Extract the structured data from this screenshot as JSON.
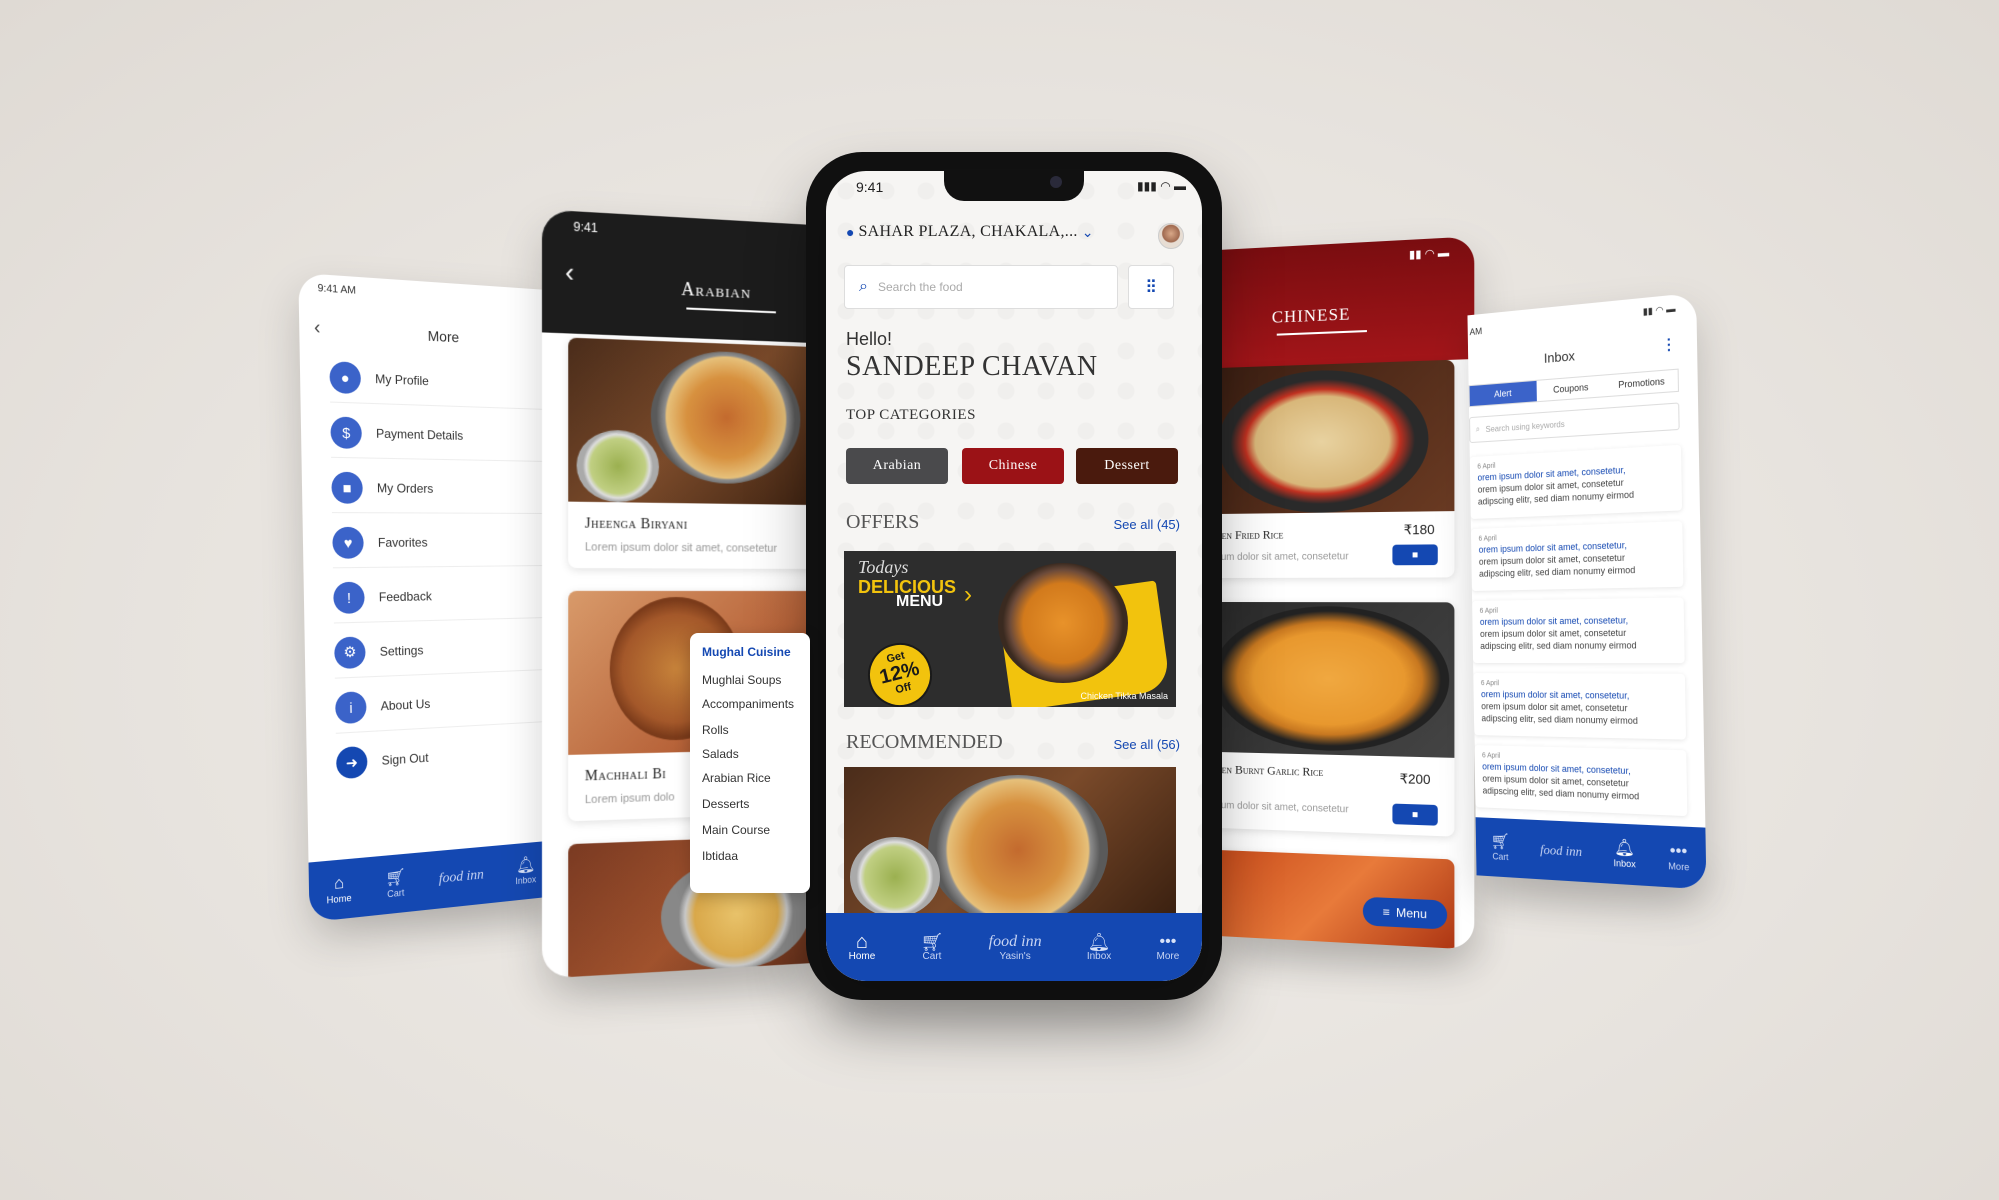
{
  "colors": {
    "brand_blue": "#1448b2",
    "arabian_grey": "#4a4a4c",
    "chinese_red": "#9b1216",
    "dessert_brown": "#4a1a0d"
  },
  "more_screen": {
    "status_time": "9:41 AM",
    "title": "More",
    "items": [
      {
        "label": "My Profile",
        "icon": "user-icon"
      },
      {
        "label": "Payment Details",
        "icon": "payment-icon"
      },
      {
        "label": "My Orders",
        "icon": "bag-icon"
      },
      {
        "label": "Favorites",
        "icon": "heart-icon"
      },
      {
        "label": "Feedback",
        "icon": "feedback-icon"
      },
      {
        "label": "Settings",
        "icon": "gear-icon"
      },
      {
        "label": "About Us",
        "icon": "info-icon"
      },
      {
        "label": "Sign Out",
        "icon": "signout-icon"
      }
    ],
    "nav": {
      "home": "Home",
      "cart": "Cart",
      "inbox": "Inbox"
    }
  },
  "arabian_screen": {
    "status_time": "9:41",
    "title": "Arabian",
    "cards": [
      {
        "name": "Jheenga Biryani",
        "desc": "Lorem ipsum dolor sit amet, consetetur"
      },
      {
        "name": "Machhali Bi",
        "desc": "Lorem ipsum dolo"
      }
    ],
    "menu_dropdown": [
      "Mughal Cuisine",
      "Mughlai Soups",
      "Accompaniments",
      "Rolls",
      "Salads",
      "Arabian Rice",
      "Desserts",
      "Main Course",
      "Ibtidaa"
    ]
  },
  "home_screen": {
    "status_time": "9:41",
    "location": "Sahar Plaza, Chakala,...",
    "search_placeholder": "Search the food",
    "greeting": "Hello!",
    "user_name": "Sandeep Chavan",
    "categories_title": "Top Categories",
    "categories": [
      "Arabian",
      "Chinese",
      "Dessert"
    ],
    "offers_title": "Offers",
    "offers_see_all": "See all (45)",
    "banner": {
      "line1": "Todays",
      "line2": "DELICIOUS",
      "line3": "MENU",
      "badge_get": "Get",
      "badge_pct": "12%",
      "badge_off": "Off",
      "dish": "Chicken Tikka Masala"
    },
    "recommended_title": "Recommended",
    "recommended_see_all": "See all (56)",
    "nav": {
      "home": "Home",
      "cart": "Cart",
      "brand": "Yasin's",
      "inbox": "Inbox",
      "more": "More"
    }
  },
  "chinese_screen": {
    "title": "Chinese",
    "cards": [
      {
        "name": "ken Fried Rice",
        "price": "₹180",
        "desc": "sum dolor sit amet, consetetur"
      },
      {
        "name": "ken Burnt Garlic Rice",
        "price": "₹200",
        "desc": "sum dolor sit amet, consetetur"
      }
    ],
    "menu_button": "Menu"
  },
  "inbox_screen": {
    "status_time": "AM",
    "title": "Inbox",
    "tabs": [
      "Alert",
      "Coupons",
      "Promotions"
    ],
    "search_placeholder": "Search using keywords",
    "messages": [
      {
        "date": "6 April",
        "line1": "orem ipsum dolor sit amet, consetetur,",
        "line2": "orem ipsum dolor sit amet, consetetur",
        "line3": "adipscing elitr, sed diam nonumy eirmod"
      },
      {
        "date": "6 April",
        "line1": "orem ipsum dolor sit amet, consetetur,",
        "line2": "orem ipsum dolor sit amet, consetetur",
        "line3": "adipscing elitr, sed diam nonumy eirmod"
      },
      {
        "date": "6 April",
        "line1": "orem ipsum dolor sit amet, consetetur,",
        "line2": "orem ipsum dolor sit amet, consetetur",
        "line3": "adipscing elitr, sed diam nonumy eirmod"
      },
      {
        "date": "6 April",
        "line1": "orem ipsum dolor sit amet, consetetur,",
        "line2": "orem ipsum dolor sit amet, consetetur",
        "line3": "adipscing elitr, sed diam nonumy eirmod"
      },
      {
        "date": "6 April",
        "line1": "orem ipsum dolor sit amet, consetetur,",
        "line2": "orem ipsum dolor sit amet, consetetur",
        "line3": "adipscing elitr, sed diam nonumy eirmod"
      }
    ],
    "nav": {
      "cart": "Cart",
      "inbox": "Inbox",
      "more": "More"
    }
  }
}
